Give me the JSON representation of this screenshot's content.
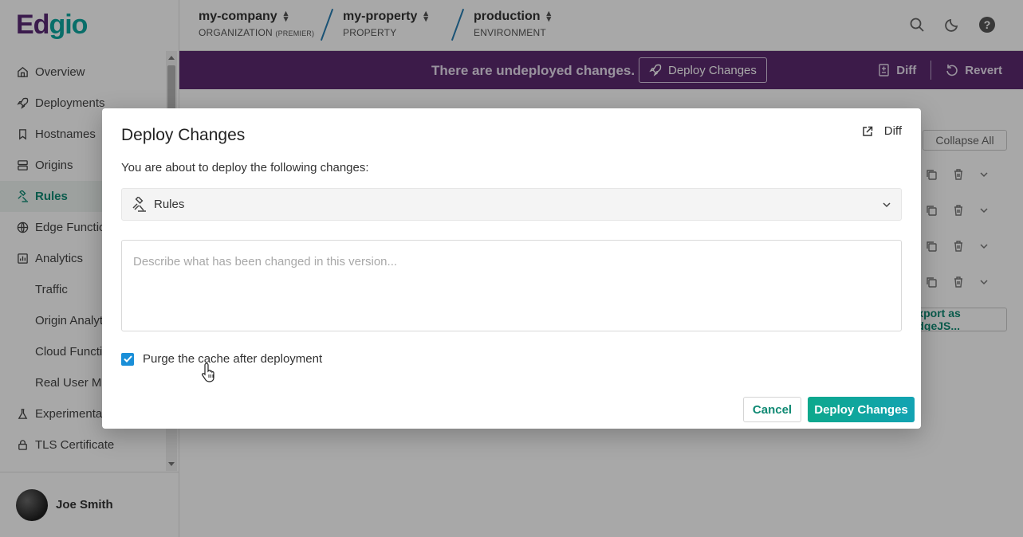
{
  "logo": {
    "part1": "Ed",
    "part2": "gio"
  },
  "sidebar": {
    "items": [
      {
        "label": "Overview",
        "icon": "home-icon"
      },
      {
        "label": "Deployments",
        "icon": "rocket-icon"
      },
      {
        "label": "Hostnames",
        "icon": "bookmark-icon"
      },
      {
        "label": "Origins",
        "icon": "server-icon"
      },
      {
        "label": "Rules",
        "icon": "gavel-icon",
        "active": true
      },
      {
        "label": "Edge Functions",
        "icon": "globe-icon"
      },
      {
        "label": "Analytics",
        "icon": "chart-icon"
      },
      {
        "label": "Traffic",
        "sub": true
      },
      {
        "label": "Origin Analytics",
        "sub": true
      },
      {
        "label": "Cloud Functions",
        "sub": true
      },
      {
        "label": "Real User Monitoring",
        "sub": true
      },
      {
        "label": "Experimentation",
        "icon": "flask-icon"
      },
      {
        "label": "TLS Certificate",
        "icon": "lock-icon"
      }
    ]
  },
  "user": {
    "name": "Joe Smith"
  },
  "header": {
    "org": {
      "name": "my-company",
      "type": "ORGANIZATION",
      "tier": "(PREMIER)"
    },
    "property": {
      "name": "my-property",
      "type": "PROPERTY"
    },
    "environment": {
      "name": "production",
      "type": "ENVIRONMENT"
    }
  },
  "banner": {
    "message": "There are undeployed changes.",
    "deploy_label": "Deploy Changes",
    "diff_label": "Diff",
    "revert_label": "Revert"
  },
  "background": {
    "collapse_all": "Collapse All",
    "export_label": "Export as EdgeJS..."
  },
  "modal": {
    "title": "Deploy Changes",
    "diff_label": "Diff",
    "description": "You are about to deploy the following changes:",
    "section_label": "Rules",
    "textarea_placeholder": "Describe what has been changed in this version...",
    "purge_label": "Purge the cache after deployment",
    "purge_checked": true,
    "cancel_label": "Cancel",
    "deploy_label": "Deploy Changes"
  },
  "colors": {
    "brand_purple": "#5b2a6f",
    "brand_teal": "#0fa7a0",
    "checkbox_blue": "#1a8fd8"
  }
}
